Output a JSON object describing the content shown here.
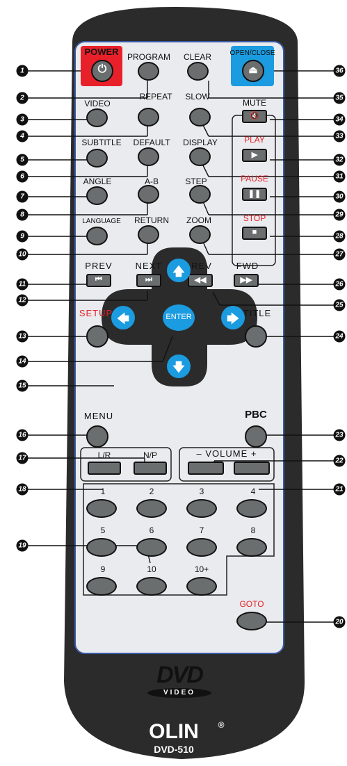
{
  "buttons": {
    "power": "POWER",
    "program": "PROGRAM",
    "clear": "CLEAR",
    "open_close": "OPEN/CLOSE",
    "video": "VIDEO",
    "repeat": "REPEAT",
    "slow": "SLOW",
    "mute": "MUTE",
    "subtitle": "SUBTITLE",
    "default": "DEFAULT",
    "display": "DISPLAY",
    "play": "PLAY",
    "angle": "ANGLE",
    "a_b": "A-B",
    "step": "STEP",
    "pause": "PAUSE",
    "language": "LANGUAGE",
    "return": "RETURN",
    "zoom": "ZOOM",
    "stop": "STOP",
    "prev": "PREV",
    "next": "NEXT",
    "rev": "REV",
    "fwd": "FWD",
    "setup": "SETUP",
    "title": "TITLE",
    "enter": "ENTER",
    "menu": "MENU",
    "pbc": "PBC",
    "lr": "L/R",
    "np": "N/P",
    "volume": "–  VOLUME  +",
    "goto": "GOTO"
  },
  "digits": [
    "1",
    "2",
    "3",
    "4",
    "5",
    "6",
    "7",
    "8",
    "9",
    "10",
    "10+"
  ],
  "callouts": [
    "1",
    "2",
    "3",
    "4",
    "5",
    "6",
    "7",
    "8",
    "9",
    "10",
    "11",
    "12",
    "13",
    "14",
    "15",
    "16",
    "17",
    "18",
    "19",
    "20",
    "21",
    "22",
    "23",
    "24",
    "25",
    "26",
    "27",
    "28",
    "29",
    "30",
    "31",
    "32",
    "33",
    "34",
    "35",
    "36"
  ],
  "brand": {
    "logo": "DVD",
    "logo_sub": "VIDEO",
    "name": "OLIN",
    "registered": "®",
    "model": "DVD-510"
  },
  "colors": {
    "accent_red": "#e8202a",
    "accent_blue": "#1b9be0",
    "body": "#2b2b2b",
    "face": "#e9ebee",
    "button": "#6b6e6e"
  }
}
